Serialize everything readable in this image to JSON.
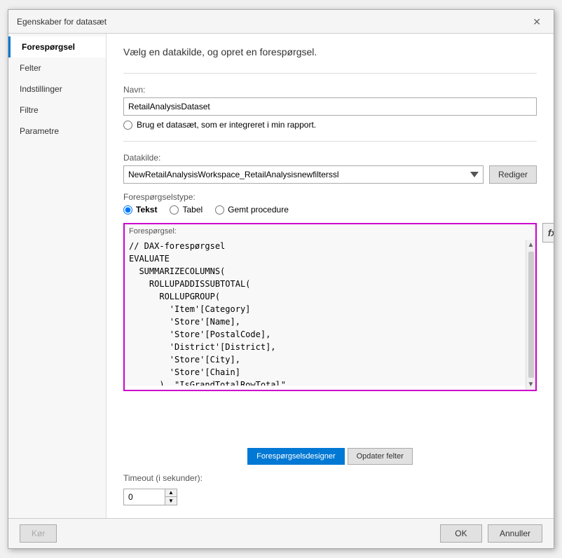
{
  "dialog": {
    "title": "Egenskaber for datasæt",
    "close_label": "✕"
  },
  "sidebar": {
    "items": [
      {
        "id": "forespørgsel",
        "label": "Forespørgsel",
        "active": true
      },
      {
        "id": "felter",
        "label": "Felter",
        "active": false
      },
      {
        "id": "indstillinger",
        "label": "Indstillinger",
        "active": false
      },
      {
        "id": "filtre",
        "label": "Filtre",
        "active": false
      },
      {
        "id": "parametre",
        "label": "Parametre",
        "active": false
      }
    ]
  },
  "main": {
    "section_title": "Vælg en datakilde, og opret en forespørgsel.",
    "name_label": "Navn:",
    "name_value": "RetailAnalysisDataset",
    "radio_label": "Brug et datasæt, som er integreret i min rapport.",
    "datasource_label": "Datakilde:",
    "datasource_value": "NewRetailAnalysisWorkspace_RetailAnalysisnewfilterssl",
    "datasource_edit_label": "Rediger",
    "query_type_label": "Forespørgselstype:",
    "query_types": [
      {
        "id": "tekst",
        "label": "Tekst",
        "active": true
      },
      {
        "id": "tabel",
        "label": "Tabel",
        "active": false
      },
      {
        "id": "gemt",
        "label": "Gemt procedure",
        "active": false
      }
    ],
    "query_editor_label": "Forespørgsel:",
    "query_comment": "// DAX-forespørgsel",
    "query_text": "EVALUATE\n  SUMMARIZECOLUMNS(\n    ROLLUPADDISSUBTOTAL(\n      ROLLUPGROUP(\n        'Item'[Category]\n        'Store'[Name],\n        'Store'[PostalCode],\n        'District'[District],\n        'Store'[City],\n        'Store'[Chain]\n      ), \"IsGrandTotalRowTotal\"\n    ),\n    \"This Year Sales\", 'Sales'[This Year Sales]",
    "fx_label": "fx",
    "btn_query_designer": "Forespørgselsdesigner",
    "btn_update_fields": "Opdater felter",
    "timeout_label": "Timeout (i sekunder):",
    "timeout_value": "0"
  },
  "footer": {
    "btn_left1": "Kør",
    "btn_ok": "OK",
    "btn_cancel": "Annuller"
  }
}
